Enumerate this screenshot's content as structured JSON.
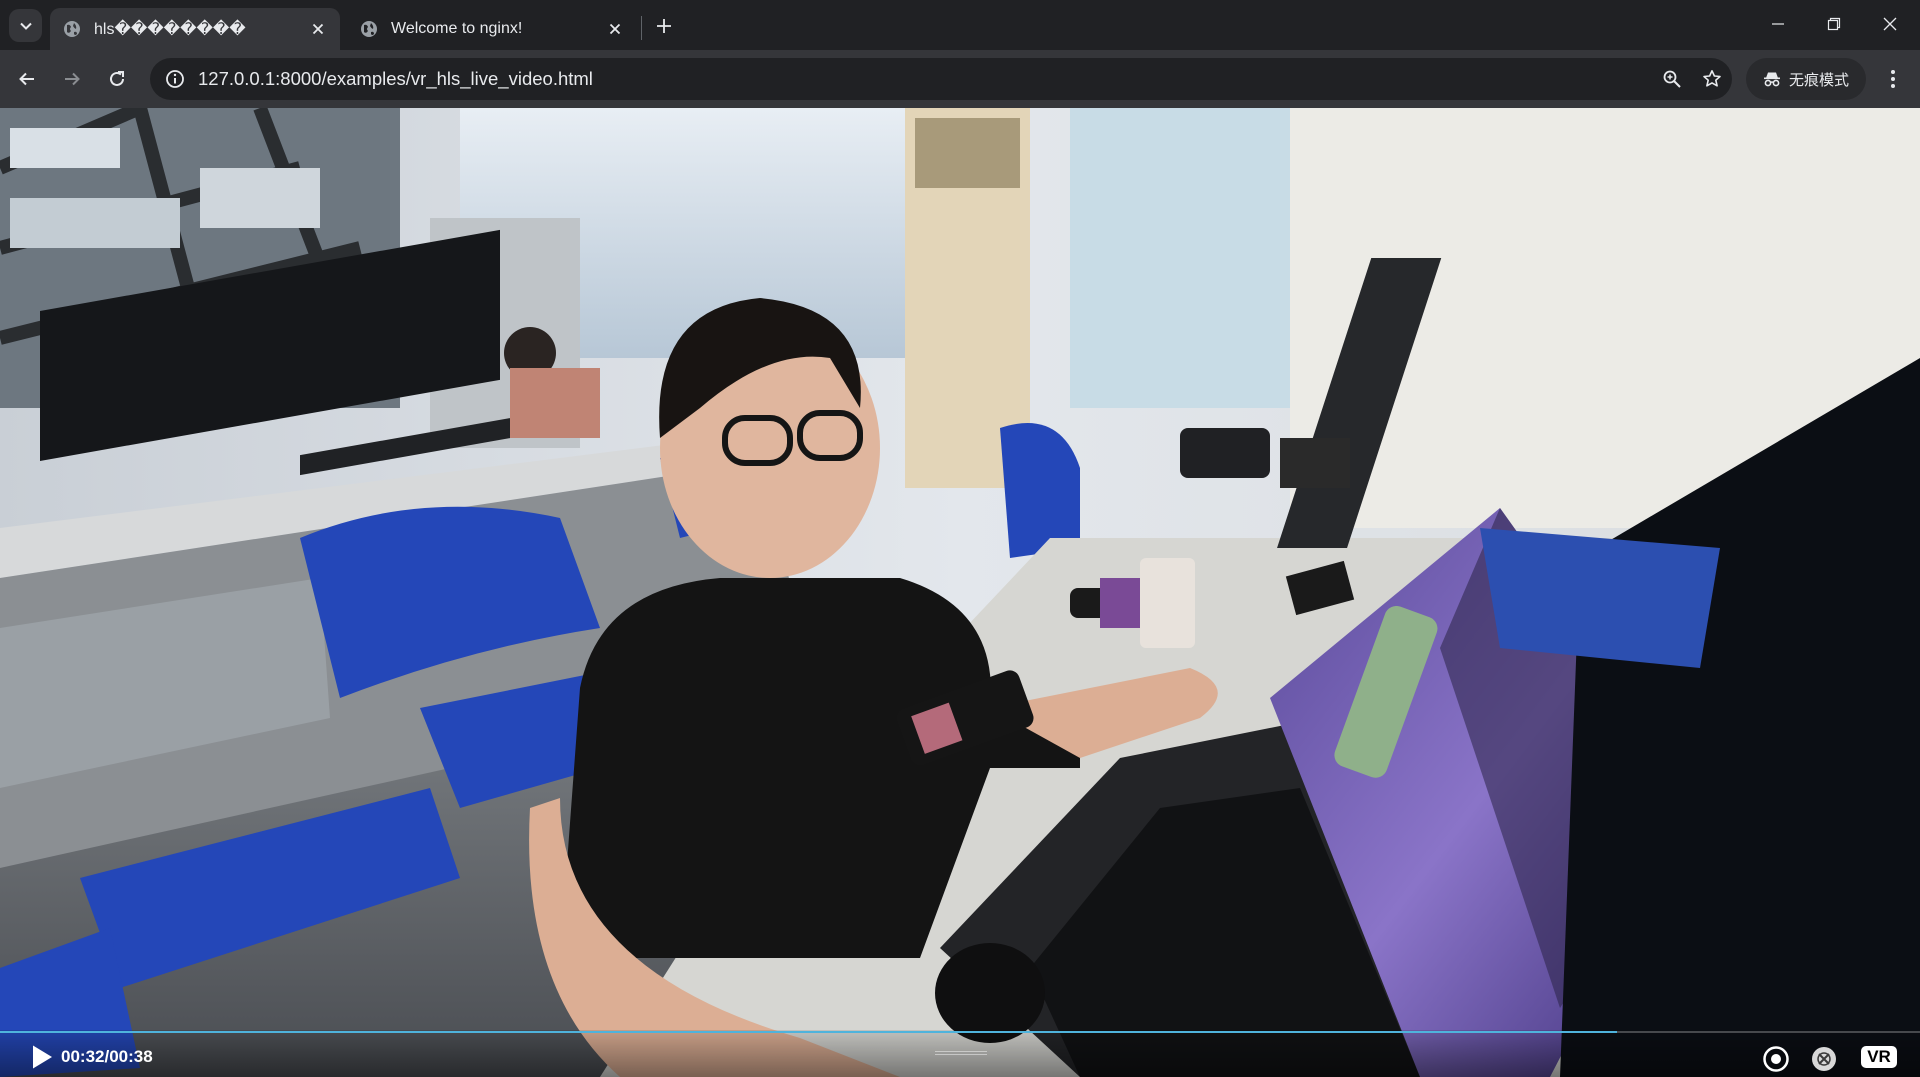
{
  "tabs": [
    {
      "title": "hls��������",
      "active": true,
      "favicon": "globe-icon"
    },
    {
      "title": "Welcome to nginx!",
      "active": false,
      "favicon": "globe-icon"
    }
  ],
  "toolbar": {
    "url": "127.0.0.1:8000/examples/vr_hls_live_video.html",
    "incognito_label": "无痕模式"
  },
  "player": {
    "time_display": "00:32/00:38",
    "progress_fraction": 0.842,
    "vr_label": "VR",
    "accent_color": "#4fb3dc"
  },
  "colors": {
    "tabstrip_bg": "#202124",
    "toolbar_bg": "#35363a",
    "omnibox_bg": "#202124"
  }
}
